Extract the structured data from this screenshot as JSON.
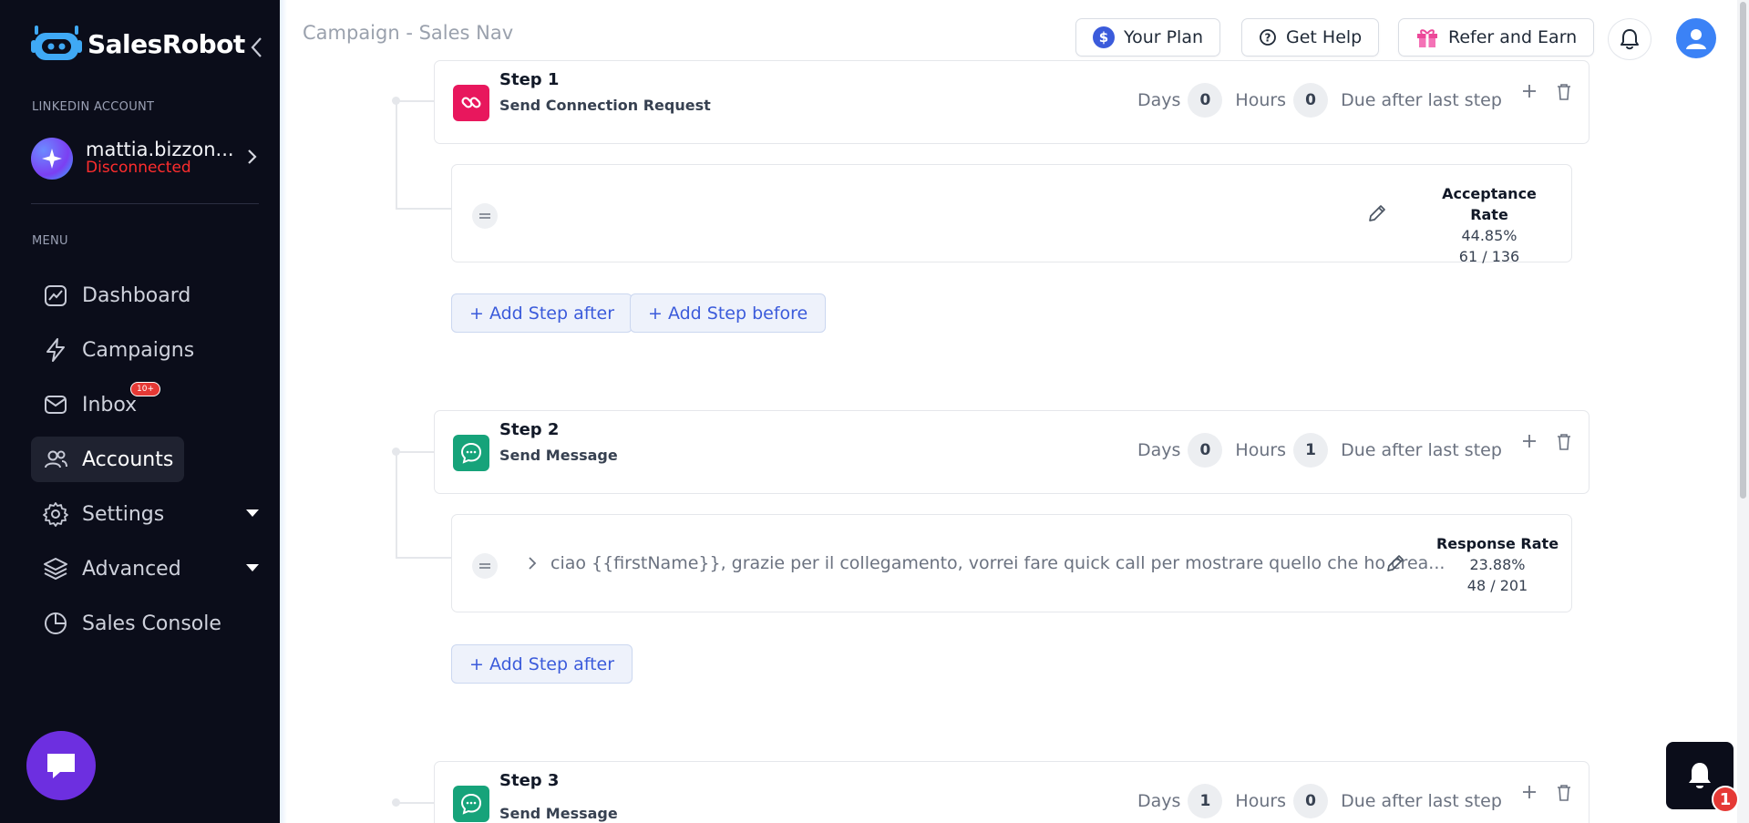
{
  "app": {
    "name": "SalesRobot"
  },
  "sidebar": {
    "linkedin_label": "LINKEDIN ACCOUNT",
    "account": {
      "name": "mattia.bizzon...",
      "status": "Disconnected"
    },
    "menu_label": "MENU",
    "items": [
      {
        "label": "Dashboard",
        "icon": "dashboard-icon"
      },
      {
        "label": "Campaigns",
        "icon": "lightning-icon"
      },
      {
        "label": "Inbox",
        "icon": "mail-icon",
        "badge": "10+"
      },
      {
        "label": "Accounts",
        "icon": "users-icon",
        "active": true
      },
      {
        "label": "Settings",
        "icon": "gear-icon",
        "expandable": true
      },
      {
        "label": "Advanced",
        "icon": "layers-icon",
        "expandable": true
      },
      {
        "label": "Sales Console",
        "icon": "pie-chart-icon"
      }
    ]
  },
  "header": {
    "title": "Campaign - Sales Nav",
    "your_plan": "Your Plan",
    "get_help": "Get Help",
    "refer_earn": "Refer and Earn"
  },
  "steps": [
    {
      "title": "Step 1",
      "subtitle": "Send Connection Request",
      "days_label": "Days",
      "days": "0",
      "hours_label": "Hours",
      "hours": "0",
      "due": "Due after last step",
      "message": "",
      "rate_label": "Acceptance Rate",
      "rate_value": "44.85%",
      "rate_counts": "61 / 136",
      "add_after": "+ Add Step after",
      "add_before": "+ Add Step before"
    },
    {
      "title": "Step 2",
      "subtitle": "Send Message",
      "days_label": "Days",
      "days": "0",
      "hours_label": "Hours",
      "hours": "1",
      "due": "Due after last step",
      "message": "ciao {{firstName}}, grazie per il collegamento, vorrei fare quick call per mostrare quello che ho crea...",
      "rate_label": "Response Rate",
      "rate_value": "23.88%",
      "rate_counts": "48 / 201",
      "add_after": "+ Add Step after"
    },
    {
      "title": "Step 3",
      "subtitle": "Send Message",
      "days_label": "Days",
      "days": "1",
      "hours_label": "Hours",
      "hours": "0",
      "due": "Due after last step"
    }
  ],
  "notification_widget": {
    "count": "1"
  },
  "colors": {
    "sidebar_bg": "#0b0d1a",
    "step1_icon": "#e8175d",
    "message_icon": "#16a37a",
    "accent": "#3b5bdb",
    "disconnected": "#ff2d2d",
    "chat_bubble": "#6d2fe0"
  }
}
